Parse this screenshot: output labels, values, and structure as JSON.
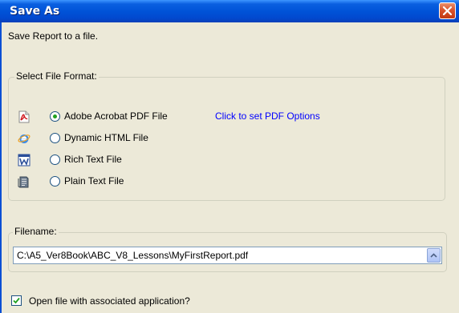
{
  "dialog": {
    "title": "Save As",
    "subtitle": "Save Report to a file."
  },
  "format_group": {
    "legend": "Select File Format:",
    "options": [
      {
        "label": "Adobe Acrobat PDF File",
        "selected": true,
        "icon": "pdf-icon"
      },
      {
        "label": "Dynamic HTML File",
        "selected": false,
        "icon": "internet-explorer-icon"
      },
      {
        "label": "Rich Text File",
        "selected": false,
        "icon": "word-document-icon"
      },
      {
        "label": "Plain Text File",
        "selected": false,
        "icon": "text-file-icon"
      }
    ],
    "pdf_options_link": "Click to set PDF Options"
  },
  "filename_group": {
    "legend": "Filename:",
    "value": "C:\\A5_Ver8Book\\ABC_V8_Lessons\\MyFirstReport.pdf"
  },
  "open_with_app": {
    "label": "Open file with associated application?",
    "checked": true
  },
  "colors": {
    "title_bar": "#0053d8",
    "dialog_bg": "#ece9d8",
    "link": "#0000ff",
    "radio_dot": "#21a121"
  }
}
